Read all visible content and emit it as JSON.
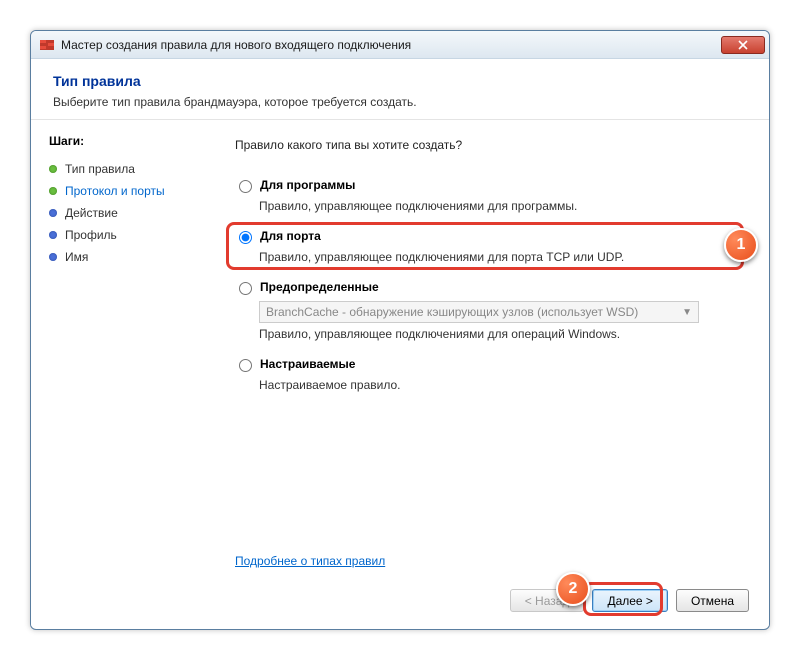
{
  "window": {
    "title": "Мастер создания правила для нового входящего подключения"
  },
  "header": {
    "title": "Тип правила",
    "subtitle": "Выберите тип правила брандмауэра, которое требуется создать."
  },
  "sidebar": {
    "steps_label": "Шаги:",
    "items": [
      {
        "label": "Тип правила"
      },
      {
        "label": "Протокол и порты"
      },
      {
        "label": "Действие"
      },
      {
        "label": "Профиль"
      },
      {
        "label": "Имя"
      }
    ]
  },
  "content": {
    "prompt": "Правило какого типа вы хотите создать?",
    "options": {
      "program": {
        "label": "Для программы",
        "desc": "Правило, управляющее подключениями для программы."
      },
      "port": {
        "label": "Для порта",
        "desc": "Правило, управляющее подключениями для порта TCP или UDP."
      },
      "predefined": {
        "label": "Предопределенные",
        "select_value": "BranchCache - обнаружение кэширующих узлов (использует WSD)",
        "desc": "Правило, управляющее подключениями для операций Windows."
      },
      "custom": {
        "label": "Настраиваемые",
        "desc": "Настраиваемое правило."
      }
    },
    "link": "Подробнее о типах правил"
  },
  "buttons": {
    "back": "< Назад",
    "next": "Далее >",
    "cancel": "Отмена"
  },
  "markers": {
    "m1": "1",
    "m2": "2"
  }
}
